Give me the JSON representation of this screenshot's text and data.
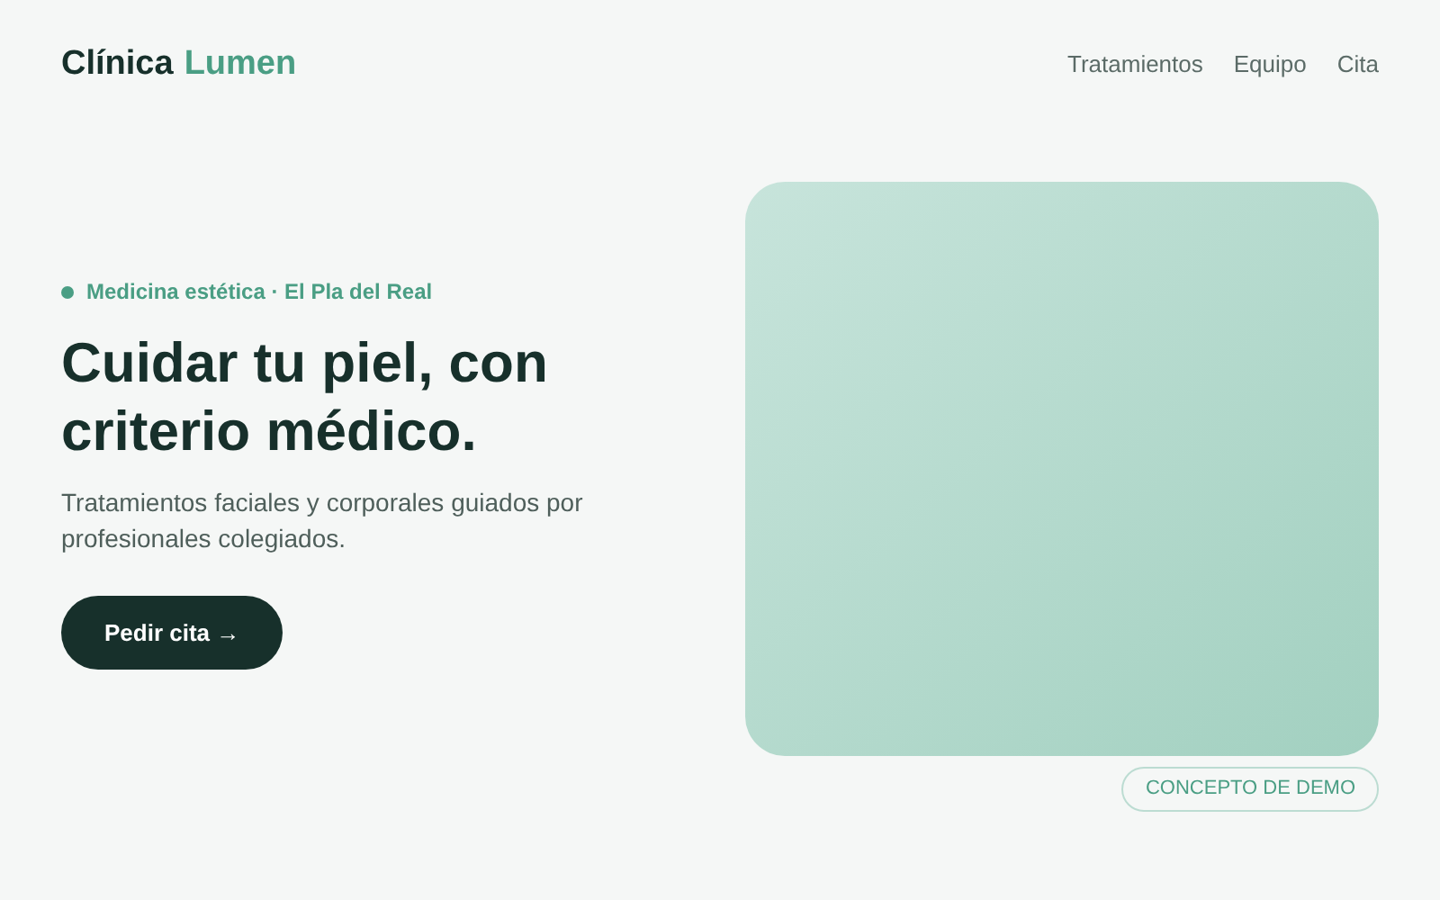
{
  "brand": {
    "name": "Clínica",
    "accent": "Lumen"
  },
  "nav": [
    {
      "label": "Tratamientos"
    },
    {
      "label": "Equipo"
    },
    {
      "label": "Cita"
    }
  ],
  "hero": {
    "eyebrow": "Medicina estética · El Pla del Real",
    "title": "Cuidar tu piel, con criterio médico.",
    "lead": "Tratamientos faciales y corporales guiados por profesionales colegiados.",
    "cta": "Pedir cita →"
  },
  "visual": {
    "badge": "CONCEPTO DE DEMO"
  }
}
